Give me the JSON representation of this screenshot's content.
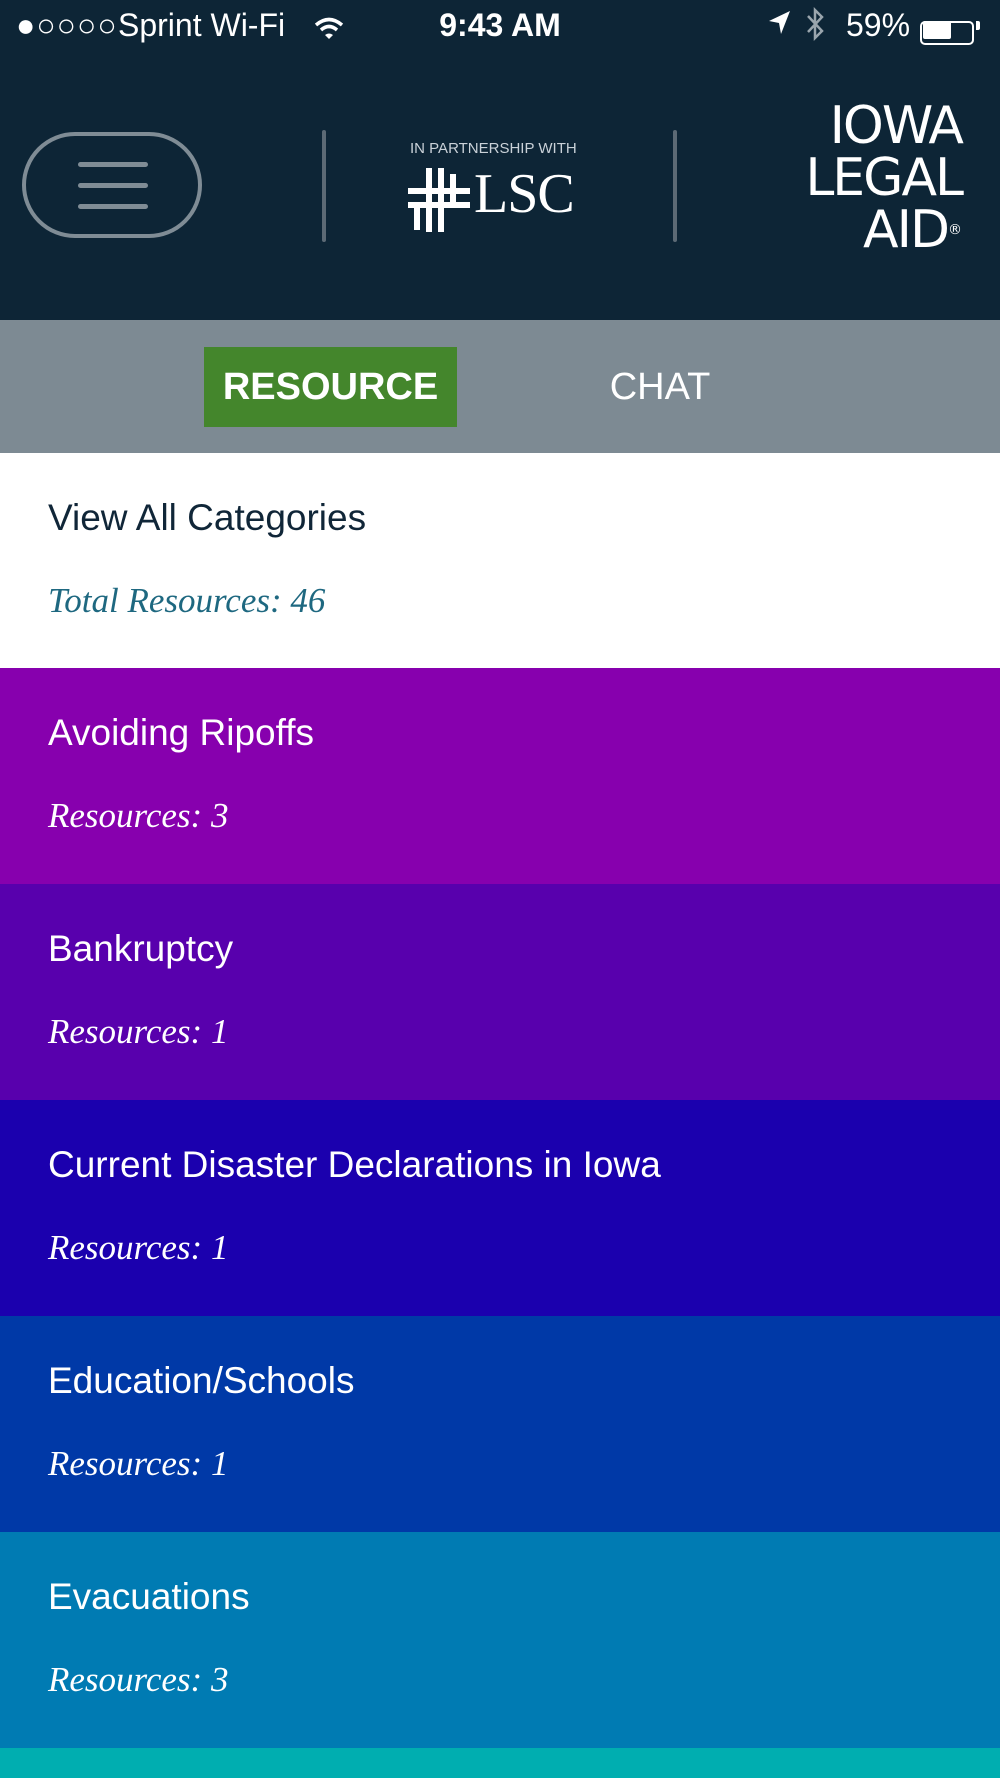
{
  "status_bar": {
    "signal": "●○○○○",
    "carrier": "Sprint Wi-Fi",
    "time": "9:43 AM",
    "battery_percent": "59%",
    "battery_level": 0.59,
    "icons": [
      "wifi-icon",
      "location-arrow-icon",
      "bluetooth-icon",
      "battery-icon"
    ]
  },
  "header": {
    "menu_icon": "hamburger-menu-icon",
    "partner_caption": "IN PARTNERSHIP WITH",
    "partner_name": "LSC",
    "org_line1": "IOWA",
    "org_line2": "LEGAL",
    "org_line3": "AID",
    "org_reg": "®"
  },
  "tabs": {
    "resource": "RESOURCE",
    "chat": "CHAT",
    "active": "resource"
  },
  "all_categories": {
    "title": "View All Categories",
    "count": "Total Resources: 46"
  },
  "categories": [
    {
      "title": "Avoiding Ripoffs",
      "count": "Resources: 3",
      "color": "#8700ae"
    },
    {
      "title": "Bankruptcy",
      "count": "Resources: 1",
      "color": "#5800ad"
    },
    {
      "title": "Current Disaster Declarations in Iowa",
      "count": "Resources: 1",
      "color": "#1b00ae"
    },
    {
      "title": "Education/Schools",
      "count": "Resources: 1",
      "color": "#0039a7"
    },
    {
      "title": "Evacuations",
      "count": "Resources: 3",
      "color": "#007bb3"
    }
  ],
  "colors": {
    "header_bg": "#0d2536",
    "tab_bar_bg": "#7d8a93",
    "tab_active_bg": "#44862c",
    "next_category_color": "#00aeb0"
  }
}
